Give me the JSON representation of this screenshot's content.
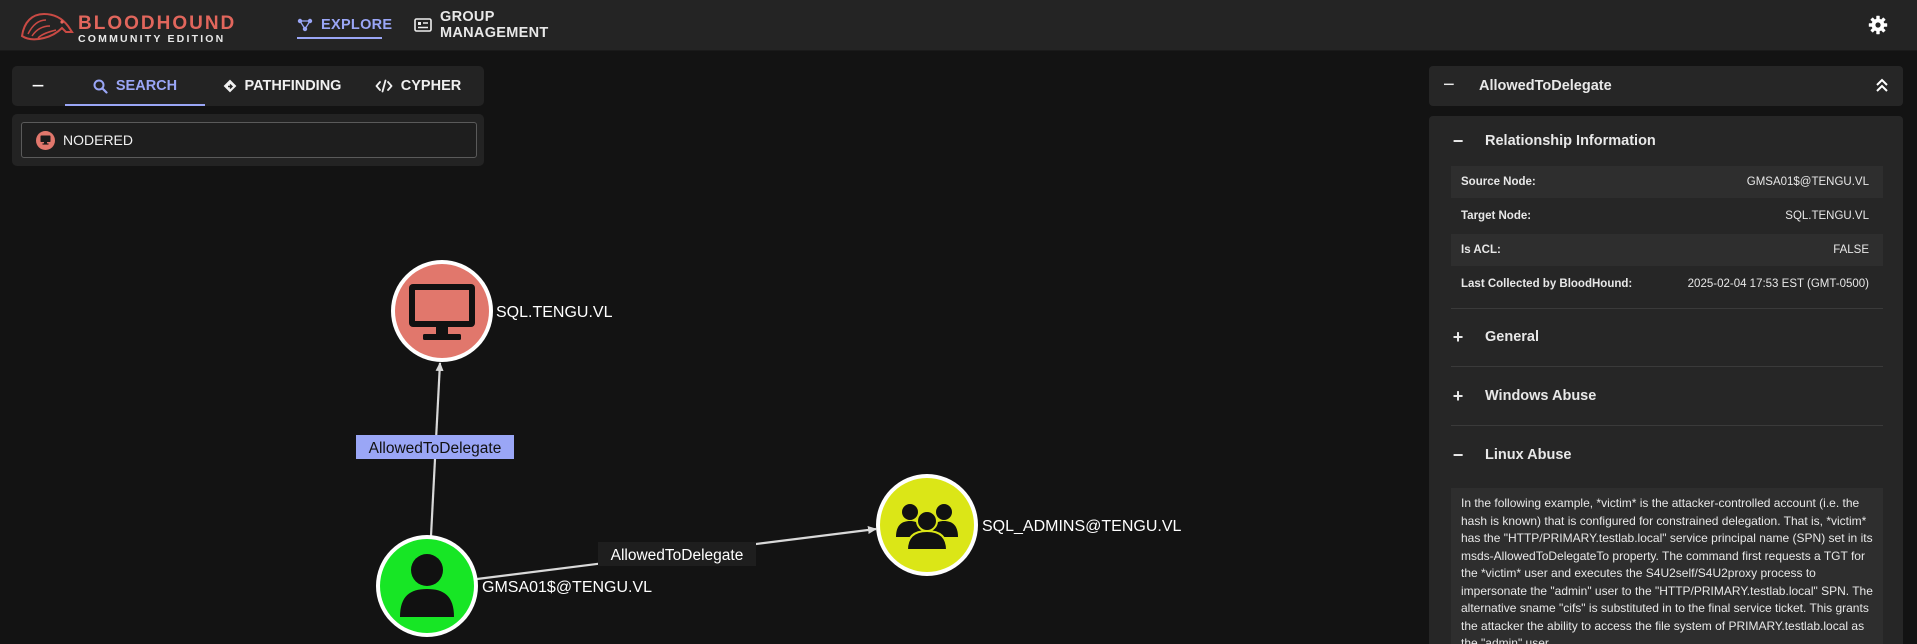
{
  "app": {
    "brand_line1": "BLOODHOUND",
    "brand_line2": "COMMUNITY EDITION",
    "nav": [
      {
        "label": "EXPLORE",
        "icon": "explore-graph-icon",
        "active": true
      },
      {
        "label": "GROUP MANAGEMENT",
        "icon": "id-card-icon",
        "active": false
      }
    ],
    "settings_icon": "gear-icon"
  },
  "search": {
    "collapse_symbol": "−",
    "tabs": [
      {
        "label": "SEARCH",
        "icon": "search-icon",
        "active": true
      },
      {
        "label": "PATHFINDING",
        "icon": "diamond-route-icon",
        "active": false
      },
      {
        "label": "CYPHER",
        "icon": "code-icon",
        "active": false
      }
    ],
    "input_value": "NODERED"
  },
  "graph": {
    "nodes": [
      {
        "id": "sql",
        "label": "SQL.TENGU.VL",
        "type": "Computer",
        "color": "#e1776c"
      },
      {
        "id": "gmsa",
        "label": "GMSA01$@TENGU.VL",
        "type": "User",
        "color": "#17e625"
      },
      {
        "id": "admins",
        "label": "SQL_ADMINS@TENGU.VL",
        "type": "Group",
        "color": "#dbe617"
      }
    ],
    "edges": [
      {
        "from": "gmsa",
        "to": "sql",
        "label": "AllowedToDelegate",
        "selected": true
      },
      {
        "from": "gmsa",
        "to": "admins",
        "label": "AllowedToDelegate",
        "selected": false
      }
    ]
  },
  "details": {
    "collapse_symbol": "−",
    "title": "AllowedToDelegate",
    "sections": {
      "relationship": {
        "symbol": "−",
        "label": "Relationship Information"
      },
      "general": {
        "symbol": "+",
        "label": "General"
      },
      "windows": {
        "symbol": "+",
        "label": "Windows Abuse"
      },
      "linux": {
        "symbol": "−",
        "label": "Linux Abuse"
      }
    },
    "properties": [
      {
        "key": "Source Node:",
        "value": "GMSA01$@TENGU.VL"
      },
      {
        "key": "Target Node:",
        "value": "SQL.TENGU.VL"
      },
      {
        "key": "Is ACL:",
        "value": "FALSE"
      },
      {
        "key": "Last Collected by BloodHound:",
        "value": "2025-02-04 17:53 EST (GMT-0500)"
      }
    ],
    "linux_abuse_text": "In the following example, *victim* is the attacker-controlled account (i.e. the hash is known) that is configured for constrained delegation. That is, *victim* has the \"HTTP/PRIMARY.testlab.local\" service principal name (SPN) set in its msds-AllowedToDelegateTo property. The command first requests a TGT for the *victim* user and executes the S4U2self/S4U2proxy process to impersonate the \"admin\" user to the \"HTTP/PRIMARY.testlab.local\" SPN. The alternative sname \"cifs\" is substituted in to the final service ticket. This grants the attacker the ability to access the file system of PRIMARY.testlab.local as the \"admin\" user."
  },
  "colors": {
    "accent": "#9aa6f6",
    "brand": "#e1665c",
    "background": "#131313",
    "panel": "#262626"
  }
}
